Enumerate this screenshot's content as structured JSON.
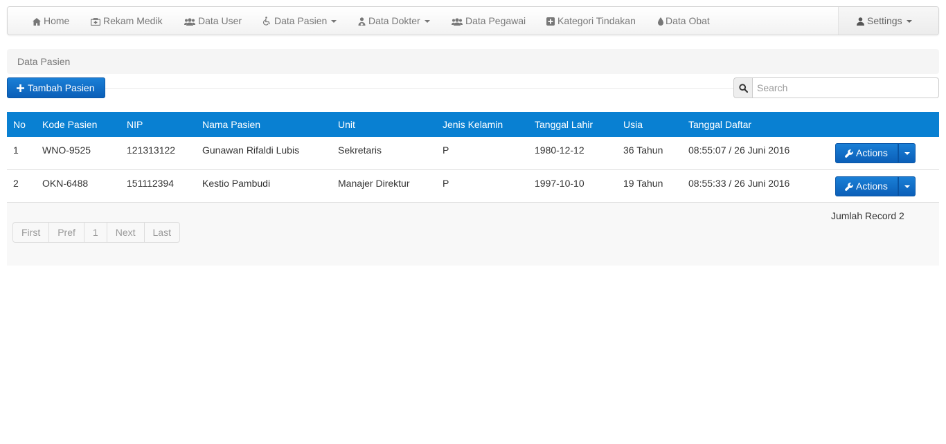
{
  "navbar": {
    "items": [
      {
        "label": "Home",
        "icon": "home-icon"
      },
      {
        "label": "Rekam Medik",
        "icon": "medkit-icon"
      },
      {
        "label": "Data User",
        "icon": "users-icon"
      },
      {
        "label": "Data Pasien",
        "icon": "wheelchair-icon",
        "dropdown": true
      },
      {
        "label": "Data Dokter",
        "icon": "doctor-icon",
        "dropdown": true
      },
      {
        "label": "Data Pegawai",
        "icon": "users-icon"
      },
      {
        "label": "Kategori Tindakan",
        "icon": "plus-square-icon"
      },
      {
        "label": "Data Obat",
        "icon": "tint-icon"
      }
    ],
    "settings_label": "Settings"
  },
  "breadcrumb": "Data Pasien",
  "toolbar": {
    "add_label": "Tambah Pasien",
    "search_placeholder": "Search"
  },
  "table": {
    "columns": [
      "No",
      "Kode Pasien",
      "NIP",
      "Nama Pasien",
      "Unit",
      "Jenis Kelamin",
      "Tanggal Lahir",
      "Usia",
      "Tanggal Daftar",
      ""
    ],
    "rows": [
      {
        "no": "1",
        "kode": "WNO-9525",
        "nip": "121313122",
        "nama": "Gunawan Rifaldi Lubis",
        "unit": "Sekretaris",
        "jk": "P",
        "lahir": "1980-12-12",
        "usia": "36 Tahun",
        "daftar": "08:55:07 / 26 Juni 2016",
        "action": "Actions"
      },
      {
        "no": "2",
        "kode": "OKN-6488",
        "nip": "151112394",
        "nama": "Kestio Pambudi",
        "unit": "Manajer Direktur",
        "jk": "P",
        "lahir": "1997-10-10",
        "usia": "19 Tahun",
        "daftar": "08:55:33 / 26 Juni 2016",
        "action": "Actions"
      }
    ]
  },
  "footer": {
    "record_count": "Jumlah Record 2",
    "pager": [
      "First",
      "Pref",
      "1",
      "Next",
      "Last"
    ]
  },
  "colors": {
    "header_blue": "#0980d2",
    "button_blue": "#0b6cc7"
  }
}
